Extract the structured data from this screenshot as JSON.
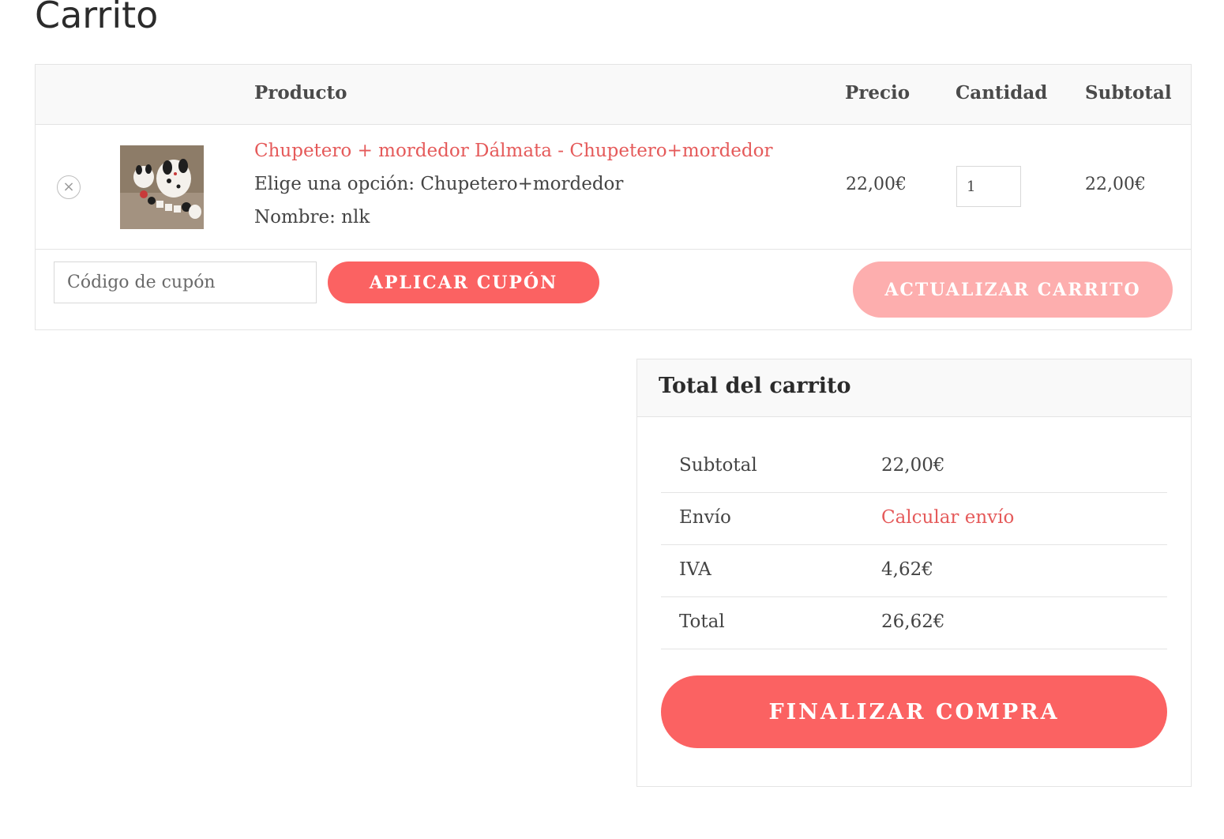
{
  "page": {
    "title": "Carrito"
  },
  "cart": {
    "headers": {
      "product": "Producto",
      "price": "Precio",
      "quantity": "Cantidad",
      "subtotal": "Subtotal"
    },
    "items": [
      {
        "name": "Chupetero + mordedor Dálmata - Chupetero+mordedor",
        "option": "Elige una opción: Chupetero+mordedor",
        "name_field": "Nombre: nlk",
        "price": "22,00€",
        "quantity": "1",
        "subtotal": "22,00€",
        "remove_icon": "×"
      }
    ],
    "coupon": {
      "placeholder": "Código de cupón",
      "apply_label": "Aplicar cupón"
    },
    "update_label": "Actualizar carrito"
  },
  "totals": {
    "title": "Total del carrito",
    "rows": [
      {
        "label": "Subtotal",
        "value": "22,00€"
      },
      {
        "label": "Envío",
        "value": "Calcular envío"
      },
      {
        "label": "IVA",
        "value": "4,62€"
      },
      {
        "label": "Total",
        "value": "26,62€"
      }
    ],
    "checkout_label": "Finalizar compra"
  },
  "colors": {
    "accent": "#fb6262",
    "accent_light": "#fdaeae",
    "link": "#e55a5a"
  }
}
